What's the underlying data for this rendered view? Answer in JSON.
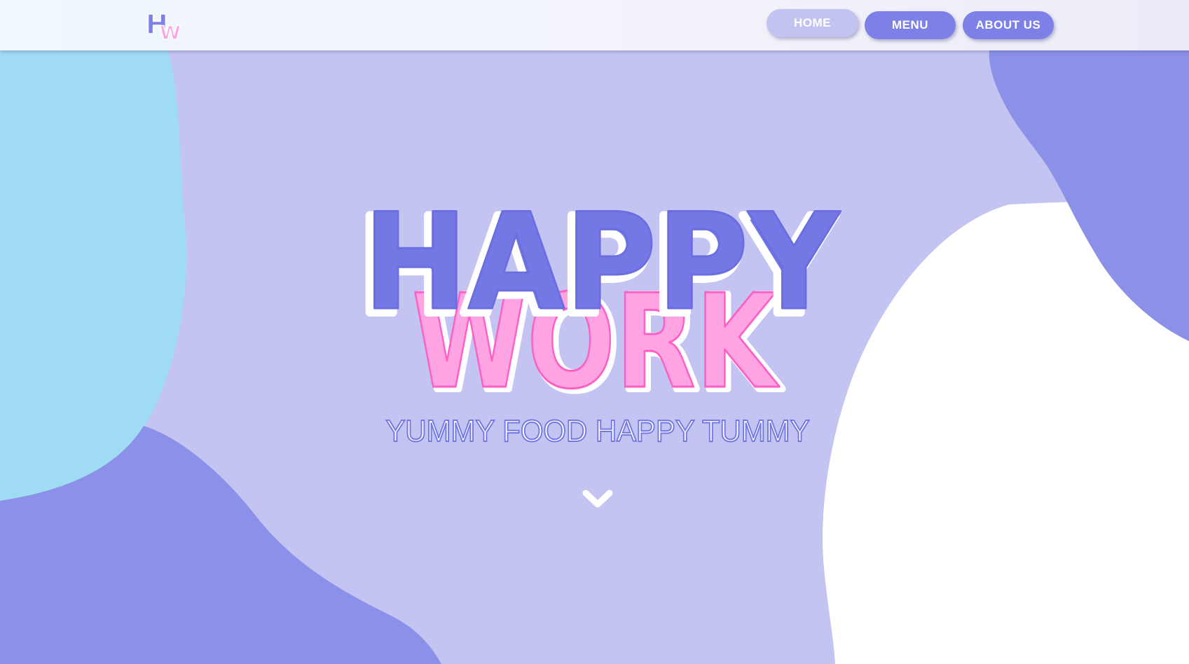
{
  "brand": {
    "logo_letters": [
      "H",
      "W"
    ],
    "logo_colors": [
      "#7d80e6",
      "#ffa4e3"
    ]
  },
  "nav": {
    "items": [
      {
        "label": "HOME",
        "active": true
      },
      {
        "label": "MENU",
        "active": false
      },
      {
        "label": "ABOUT US",
        "active": false
      }
    ]
  },
  "hero": {
    "title_line1": "HAPPY",
    "title_line2": "WORK",
    "subtitle": "YUMMY FOOD HAPPY TUMMY",
    "scroll_icon": "chevron-down-icon"
  },
  "colors": {
    "background": "#c4c4f2",
    "blob_blue": "#a0dbf4",
    "blob_purple": "#8b90e8",
    "accent_purple": "#7478e4",
    "accent_pink": "#ffa4e3",
    "pink_outline": "#ff5fc4",
    "white": "#ffffff"
  }
}
